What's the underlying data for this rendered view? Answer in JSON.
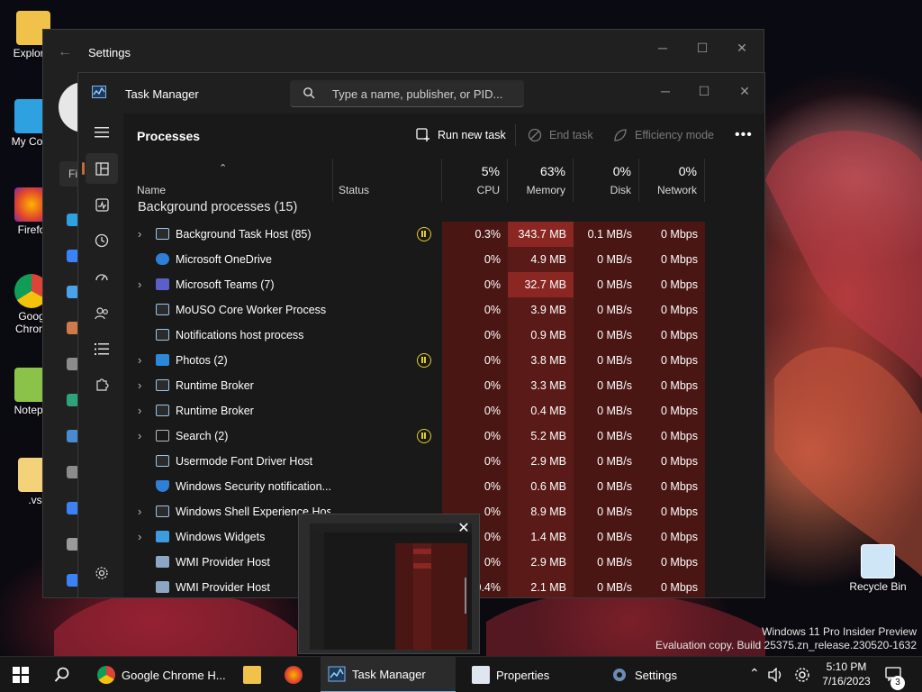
{
  "desktop": {
    "icons": [
      {
        "label": "Explorer"
      },
      {
        "label": "My Com"
      },
      {
        "label": "Firefo"
      },
      {
        "label": "Goog\nChrom"
      },
      {
        "label": "Notepa"
      },
      {
        "label": ".vs"
      },
      {
        "label": "Recycle Bin"
      }
    ],
    "watermark_line1": "Windows 11 Pro Insider Preview",
    "watermark_line2": "Evaluation copy. Build 25375.zn_release.230520-1632"
  },
  "settings_window": {
    "title": "Settings",
    "find_label": "Fi"
  },
  "task_manager": {
    "title": "Task Manager",
    "search_placeholder": "Type a name, publisher, or PID...",
    "page_title": "Processes",
    "run_new_task": "Run new task",
    "end_task": "End task",
    "efficiency_mode": "Efficiency mode",
    "more": "•••",
    "columns": {
      "name": "Name",
      "status": "Status",
      "cpu_pct": "5%",
      "cpu": "CPU",
      "memory_pct": "63%",
      "memory": "Memory",
      "disk_pct": "0%",
      "disk": "Disk",
      "network_pct": "0%",
      "network": "Network"
    },
    "group_title": "Background processes (15)",
    "processes": [
      {
        "name": "Background Task Host (85)",
        "expandable": true,
        "suspended": true,
        "cpu": "0.3%",
        "memory": "343.7 MB",
        "disk": "0.1 MB/s",
        "network": "0 Mbps",
        "icon": "app-window-icon"
      },
      {
        "name": "Microsoft OneDrive",
        "expandable": false,
        "suspended": false,
        "cpu": "0%",
        "memory": "4.9 MB",
        "disk": "0 MB/s",
        "network": "0 Mbps",
        "icon": "onedrive-cloud-icon"
      },
      {
        "name": "Microsoft Teams (7)",
        "expandable": true,
        "suspended": false,
        "cpu": "0%",
        "memory": "32.7 MB",
        "disk": "0 MB/s",
        "network": "0 Mbps",
        "icon": "teams-icon"
      },
      {
        "name": "MoUSO Core Worker Process",
        "expandable": false,
        "suspended": false,
        "cpu": "0%",
        "memory": "3.9 MB",
        "disk": "0 MB/s",
        "network": "0 Mbps",
        "icon": "app-window-icon"
      },
      {
        "name": "Notifications host process",
        "expandable": false,
        "suspended": false,
        "cpu": "0%",
        "memory": "0.9 MB",
        "disk": "0 MB/s",
        "network": "0 Mbps",
        "icon": "app-window-icon"
      },
      {
        "name": "Photos (2)",
        "expandable": true,
        "suspended": true,
        "cpu": "0%",
        "memory": "3.8 MB",
        "disk": "0 MB/s",
        "network": "0 Mbps",
        "icon": "photos-icon"
      },
      {
        "name": "Runtime Broker",
        "expandable": true,
        "suspended": false,
        "cpu": "0%",
        "memory": "3.3 MB",
        "disk": "0 MB/s",
        "network": "0 Mbps",
        "icon": "app-window-icon"
      },
      {
        "name": "Runtime Broker",
        "expandable": true,
        "suspended": false,
        "cpu": "0%",
        "memory": "0.4 MB",
        "disk": "0 MB/s",
        "network": "0 Mbps",
        "icon": "app-window-icon"
      },
      {
        "name": "Search (2)",
        "expandable": true,
        "suspended": true,
        "cpu": "0%",
        "memory": "5.2 MB",
        "disk": "0 MB/s",
        "network": "0 Mbps",
        "icon": "search-box-icon"
      },
      {
        "name": "Usermode Font Driver Host",
        "expandable": false,
        "suspended": false,
        "cpu": "0%",
        "memory": "2.9 MB",
        "disk": "0 MB/s",
        "network": "0 Mbps",
        "icon": "app-window-icon"
      },
      {
        "name": "Windows Security notification...",
        "expandable": false,
        "suspended": false,
        "cpu": "0%",
        "memory": "0.6 MB",
        "disk": "0 MB/s",
        "network": "0 Mbps",
        "icon": "shield-icon"
      },
      {
        "name": "Windows Shell Experience Host",
        "expandable": true,
        "suspended": false,
        "cpu": "0%",
        "memory": "8.9 MB",
        "disk": "0 MB/s",
        "network": "0 Mbps",
        "icon": "app-window-icon"
      },
      {
        "name": "Windows Widgets",
        "expandable": true,
        "suspended": false,
        "cpu": "0%",
        "memory": "1.4 MB",
        "disk": "0 MB/s",
        "network": "0 Mbps",
        "icon": "widgets-icon"
      },
      {
        "name": "WMI Provider Host",
        "expandable": false,
        "suspended": false,
        "cpu": "0%",
        "memory": "2.9 MB",
        "disk": "0 MB/s",
        "network": "0 Mbps",
        "icon": "wmi-icon"
      },
      {
        "name": "WMI Provider Host",
        "expandable": false,
        "suspended": false,
        "cpu": "0.4%",
        "memory": "2.1 MB",
        "disk": "0 MB/s",
        "network": "0 Mbps",
        "icon": "wmi-icon"
      }
    ]
  },
  "taskbar": {
    "items": [
      {
        "label": "Google Chrome H..."
      },
      {
        "label": "Task Manager"
      },
      {
        "label": "Properties"
      },
      {
        "label": "Settings"
      }
    ],
    "time": "5:10 PM",
    "date": "7/16/2023",
    "notification_count": "3"
  },
  "colors": {
    "accent": "#c66a3a",
    "heat_low": "#4a1614",
    "heat_mid": "#5a1b18",
    "heat_high": "#8a2723",
    "suspended": "#e4cf2a"
  }
}
